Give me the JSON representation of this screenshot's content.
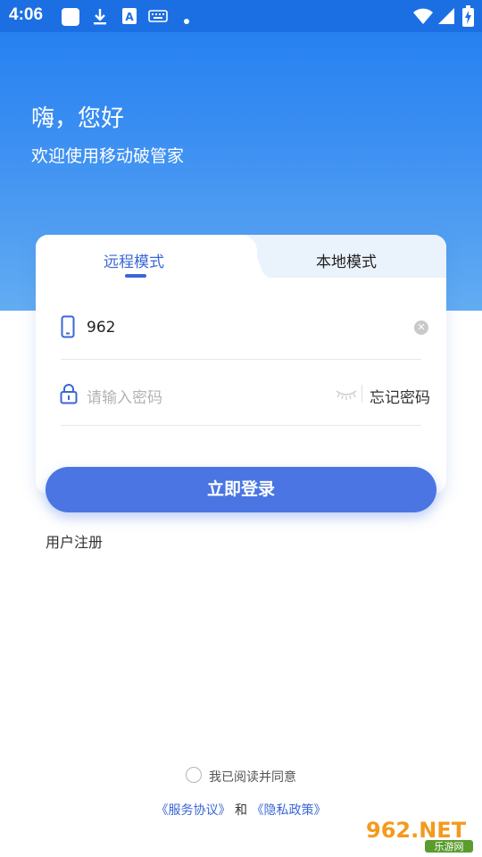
{
  "status_bar": {
    "time": "4:06",
    "icons": [
      "app-icon",
      "download-icon",
      "a-badge-icon",
      "keyboard-icon",
      "dot-icon",
      "wifi-icon",
      "signal-icon",
      "battery-charging-icon"
    ]
  },
  "header": {
    "greeting": "嗨，您好",
    "subtitle": "欢迎使用移动破管家"
  },
  "tabs": [
    {
      "label": "远程模式",
      "active": true
    },
    {
      "label": "本地模式",
      "active": false
    }
  ],
  "form": {
    "phone_value": "962",
    "password_placeholder": "请输入密码",
    "forgot_label": "忘记密码"
  },
  "login_button": "立即登录",
  "register_link": "用户注册",
  "agreement": {
    "text": "我已阅读并同意",
    "service": "《服务协议》",
    "and": "和",
    "privacy": "《隐私政策》"
  },
  "watermark": {
    "brand": "962.NET",
    "site": "乐游网"
  },
  "colors": {
    "accent": "#4a75e3",
    "header_blue": "#1f7df0",
    "tab_active": "#3a66d8"
  }
}
